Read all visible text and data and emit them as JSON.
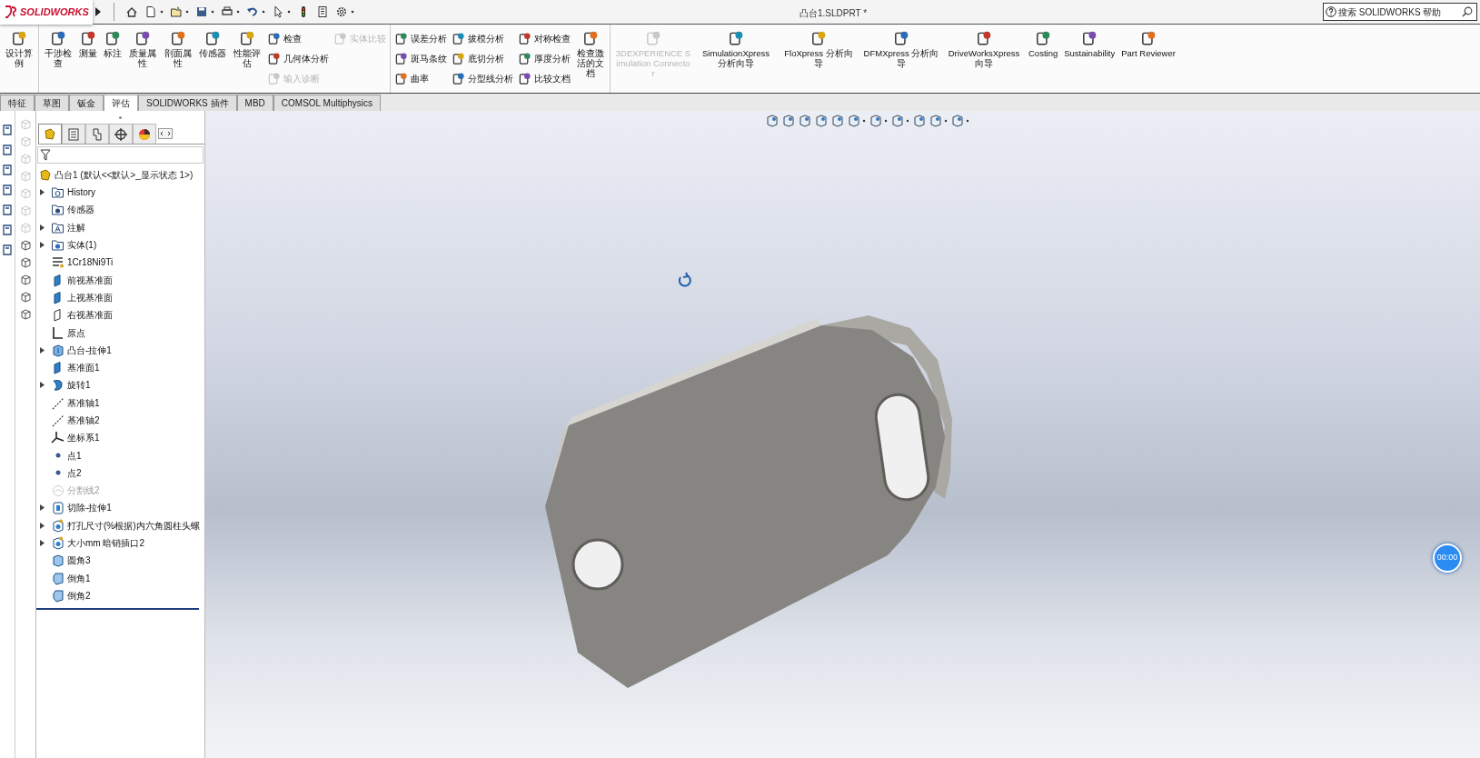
{
  "app": {
    "logo": "SOLIDWORKS"
  },
  "window": {
    "title": "凸台1.SLDPRT *"
  },
  "help_search": {
    "placeholder": "搜索 SOLIDWORKS 帮助"
  },
  "ribbon": {
    "groups": [
      {
        "blocks": [
          {
            "kind": "large",
            "label": "设计算例",
            "disabled": false
          }
        ]
      },
      {
        "blocks": [
          {
            "kind": "large",
            "label": "干涉检查",
            "disabled": false
          },
          {
            "kind": "large",
            "label": "测量",
            "disabled": false
          },
          {
            "kind": "large",
            "label": "标注",
            "disabled": false
          },
          {
            "kind": "large",
            "label": "质量属性",
            "disabled": false
          },
          {
            "kind": "large",
            "label": "剖面属性",
            "disabled": false
          },
          {
            "kind": "large",
            "label": "传感器",
            "disabled": false
          },
          {
            "kind": "large",
            "label": "性能评估",
            "disabled": false
          },
          {
            "kind": "stack",
            "items": [
              {
                "label": "检查",
                "disabled": false
              },
              {
                "label": "几何体分析",
                "disabled": false
              },
              {
                "label": "输入诊断",
                "disabled": true
              }
            ]
          },
          {
            "kind": "stack",
            "items": [
              {
                "label": "实体比较",
                "disabled": true
              }
            ]
          }
        ]
      },
      {
        "blocks": [
          {
            "kind": "stack",
            "items": [
              {
                "label": "误差分析",
                "disabled": false
              },
              {
                "label": "斑马条纹",
                "disabled": false
              },
              {
                "label": "曲率",
                "disabled": false
              }
            ]
          },
          {
            "kind": "stack",
            "items": [
              {
                "label": "拔模分析",
                "disabled": false
              },
              {
                "label": "底切分析",
                "disabled": false
              },
              {
                "label": "分型线分析",
                "disabled": false
              }
            ]
          },
          {
            "kind": "stack",
            "items": [
              {
                "label": "对称检查",
                "disabled": false
              },
              {
                "label": "厚度分析",
                "disabled": false
              },
              {
                "label": "比较文档",
                "disabled": false
              }
            ]
          },
          {
            "kind": "large",
            "label": "检查激活的文档",
            "disabled": false
          }
        ]
      },
      {
        "blocks": [
          {
            "kind": "large",
            "label": "3DEXPERIENCE Simulation Connector",
            "disabled": true
          },
          {
            "kind": "large",
            "label": "SimulationXpress 分析向导",
            "disabled": false
          },
          {
            "kind": "large",
            "label": "FloXpress 分析向导",
            "disabled": false
          },
          {
            "kind": "large",
            "label": "DFMXpress 分析向导",
            "disabled": false
          },
          {
            "kind": "large",
            "label": "DriveWorksXpress 向导",
            "disabled": false
          },
          {
            "kind": "large",
            "label": "Costing",
            "disabled": false
          },
          {
            "kind": "large",
            "label": "Sustainability",
            "disabled": false
          },
          {
            "kind": "large",
            "label": "Part Reviewer",
            "disabled": false
          }
        ]
      }
    ]
  },
  "tabs": [
    {
      "label": "特征",
      "selected": false
    },
    {
      "label": "草图",
      "selected": false
    },
    {
      "label": "钣金",
      "selected": false
    },
    {
      "label": "评估",
      "selected": true
    },
    {
      "label": "SOLIDWORKS 插件",
      "selected": false
    },
    {
      "label": "MBD",
      "selected": false
    },
    {
      "label": "COMSOL Multiphysics",
      "selected": false
    }
  ],
  "manager_tabs": [
    {
      "selected": true
    },
    {
      "selected": false
    },
    {
      "selected": false
    },
    {
      "selected": false
    },
    {
      "selected": false
    }
  ],
  "feature_tree": {
    "root": {
      "label": "凸台1  (默认<<默认>_显示状态 1>)"
    },
    "items": [
      {
        "label": "History",
        "kind": "history",
        "collapsible": true,
        "disabled": false
      },
      {
        "label": "传感器",
        "kind": "sensor",
        "collapsible": false,
        "disabled": false
      },
      {
        "label": "注解",
        "kind": "annotation",
        "collapsible": true,
        "disabled": false
      },
      {
        "label": "实体(1)",
        "kind": "solid",
        "collapsible": true,
        "disabled": false
      },
      {
        "label": "1Cr18Ni9Ti",
        "kind": "material",
        "collapsible": false,
        "disabled": false
      },
      {
        "label": "前视基准面",
        "kind": "plane",
        "collapsible": false,
        "disabled": false
      },
      {
        "label": "上视基准面",
        "kind": "plane",
        "collapsible": false,
        "disabled": false
      },
      {
        "label": "右视基准面",
        "kind": "outline",
        "collapsible": false,
        "disabled": false
      },
      {
        "label": "原点",
        "kind": "origin",
        "collapsible": false,
        "disabled": false
      },
      {
        "label": "凸台-拉伸1",
        "kind": "extrude",
        "collapsible": true,
        "disabled": false
      },
      {
        "label": "基准面1",
        "kind": "plane",
        "collapsible": false,
        "disabled": false
      },
      {
        "label": "旋转1",
        "kind": "revolve",
        "collapsible": true,
        "disabled": false
      },
      {
        "label": "基准轴1",
        "kind": "axis",
        "collapsible": false,
        "disabled": false
      },
      {
        "label": "基准轴2",
        "kind": "axis",
        "collapsible": false,
        "disabled": false
      },
      {
        "label": "坐标系1",
        "kind": "coordinate",
        "collapsible": false,
        "disabled": false
      },
      {
        "label": "点1",
        "kind": "point",
        "collapsible": false,
        "disabled": false
      },
      {
        "label": "点2",
        "kind": "point",
        "collapsible": false,
        "disabled": false
      },
      {
        "label": "分割线2",
        "kind": "split",
        "collapsible": false,
        "disabled": true
      },
      {
        "label": "切除-拉伸1",
        "kind": "cut",
        "collapsible": true,
        "disabled": false
      },
      {
        "label": "打孔尺寸(%根据)内六角圆柱头螺",
        "kind": "hole",
        "collapsible": true,
        "disabled": false
      },
      {
        "label": "大小mm 暗销插口2",
        "kind": "hole",
        "collapsible": true,
        "disabled": false
      },
      {
        "label": "圆角3",
        "kind": "fillet",
        "collapsible": false,
        "disabled": false
      },
      {
        "label": "倒角1",
        "kind": "chamfer",
        "collapsible": false,
        "disabled": false
      },
      {
        "label": "倒角2",
        "kind": "chamfer",
        "collapsible": false,
        "disabled": false
      }
    ]
  },
  "viewport": {
    "badge": "00:00"
  }
}
